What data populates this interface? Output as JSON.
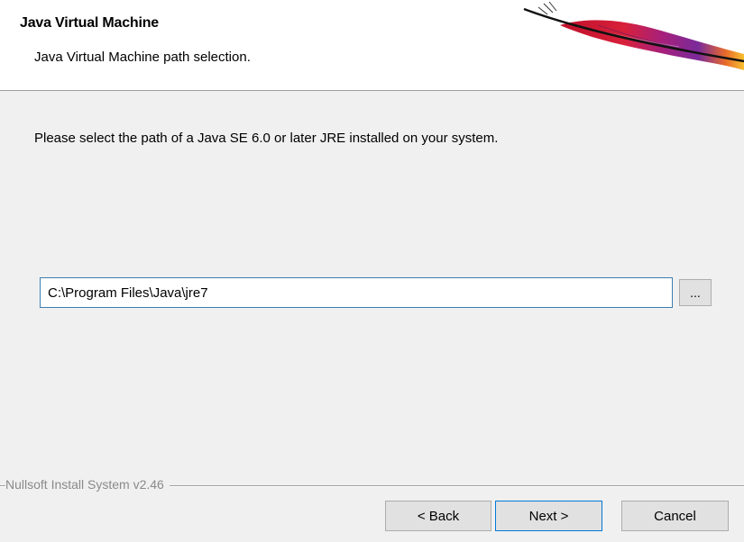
{
  "header": {
    "title": "Java Virtual Machine",
    "subtitle": "Java Virtual Machine path selection.",
    "logo_icon": "apache-feather-logo-icon"
  },
  "main": {
    "instructions": "Please select the path of a Java SE 6.0 or later JRE installed on your system.",
    "jre_path_value": "C:\\Program Files\\Java\\jre7",
    "browse_label": "..."
  },
  "footer": {
    "branding": "Nullsoft Install System v2.46",
    "back_label": "< Back",
    "next_label": "Next >",
    "cancel_label": "Cancel"
  },
  "colors": {
    "accent": "#0078d7",
    "window_bg": "#f0f0f0",
    "header_bg": "#ffffff"
  }
}
